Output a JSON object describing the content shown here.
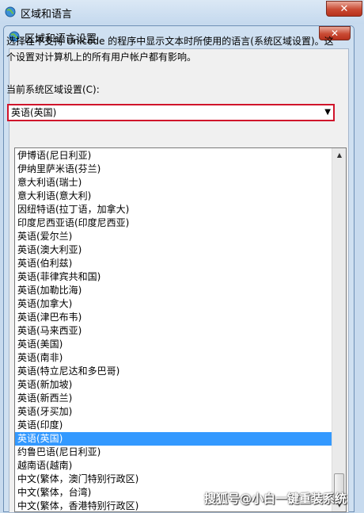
{
  "outer_window": {
    "title": "区域和语言",
    "close_glyph": "✕"
  },
  "dialog": {
    "title": "区域和语言设置",
    "close_glyph": "✕",
    "description": "选择在不支持 Unicode 的程序中显示文本时所使用的语言(系统区域设置)。这个设置对计算机上的所有用户帐户都有影响。",
    "current_label": "当前系统区域设置(C):",
    "current_value": "英语(英国)"
  },
  "locale_list": {
    "items": [
      "伊博语(尼日利亚)",
      "伊纳里萨米语(芬兰)",
      "意大利语(瑞士)",
      "意大利语(意大利)",
      "因纽特语(拉丁语，加拿大)",
      "印度尼西亚语(印度尼西亚)",
      "英语(爱尔兰)",
      "英语(澳大利亚)",
      "英语(伯利兹)",
      "英语(菲律宾共和国)",
      "英语(加勒比海)",
      "英语(加拿大)",
      "英语(津巴布韦)",
      "英语(马来西亚)",
      "英语(美国)",
      "英语(南非)",
      "英语(特立尼达和多巴哥)",
      "英语(新加坡)",
      "英语(新西兰)",
      "英语(牙买加)",
      "英语(印度)",
      "英语(英国)",
      "约鲁巴语(尼日利亚)",
      "越南语(越南)",
      "中文(繁体，澳门特别行政区)",
      "中文(繁体，台湾)",
      "中文(繁体，香港特别行政区)"
    ],
    "selected_index": 21
  },
  "watermark": "搜狐号@小白一键重装系统",
  "icons": {
    "globe": "globe-icon",
    "close": "close-icon",
    "dropdown": "dropdown-arrow-icon"
  }
}
